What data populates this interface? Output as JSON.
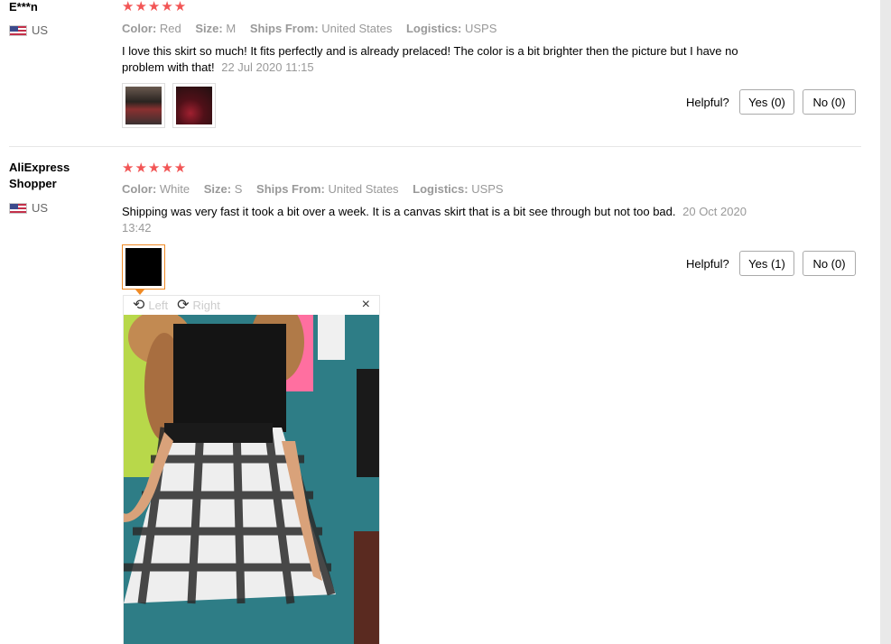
{
  "reviews": [
    {
      "buyer": "E***n",
      "country": "US",
      "stars": "★★★★★",
      "rating": 5,
      "color_label": "Color:",
      "color": "Red",
      "size_label": "Size:",
      "size": "M",
      "ships_label": "Ships From:",
      "ships_from": "United States",
      "logistics_label": "Logistics:",
      "logistics": "USPS",
      "text": "I love this skirt so much! It fits perfectly and is already prelaced! The color is a bit brighter then the picture but I have no problem with that!",
      "date": "22 Jul 2020 11:15",
      "helpful_label": "Helpful?",
      "yes_label": "Yes (0)",
      "no_label": "No (0)"
    },
    {
      "buyer": "AliExpress Shopper",
      "country": "US",
      "stars": "★★★★★",
      "rating": 5,
      "color_label": "Color:",
      "color": "White",
      "size_label": "Size:",
      "size": "S",
      "ships_label": "Ships From:",
      "ships_from": "United States",
      "logistics_label": "Logistics:",
      "logistics": "USPS",
      "text": "Shipping was very fast it took a bit over a week. It is a canvas skirt that is a bit see through but not too bad.",
      "date": "20 Oct 2020 13:42",
      "helpful_label": "Helpful?",
      "yes_label": "Yes (1)",
      "no_label": "No (0)"
    }
  ],
  "viewer": {
    "rotate_left": "Left",
    "rotate_right": "Right",
    "close": "×",
    "rotate_left_icon": "rotate-left-icon",
    "rotate_right_icon": "rotate-right-icon"
  },
  "colors": {
    "star": "#f25555",
    "active_thumb": "#f08a24",
    "muted_text": "#999999"
  }
}
